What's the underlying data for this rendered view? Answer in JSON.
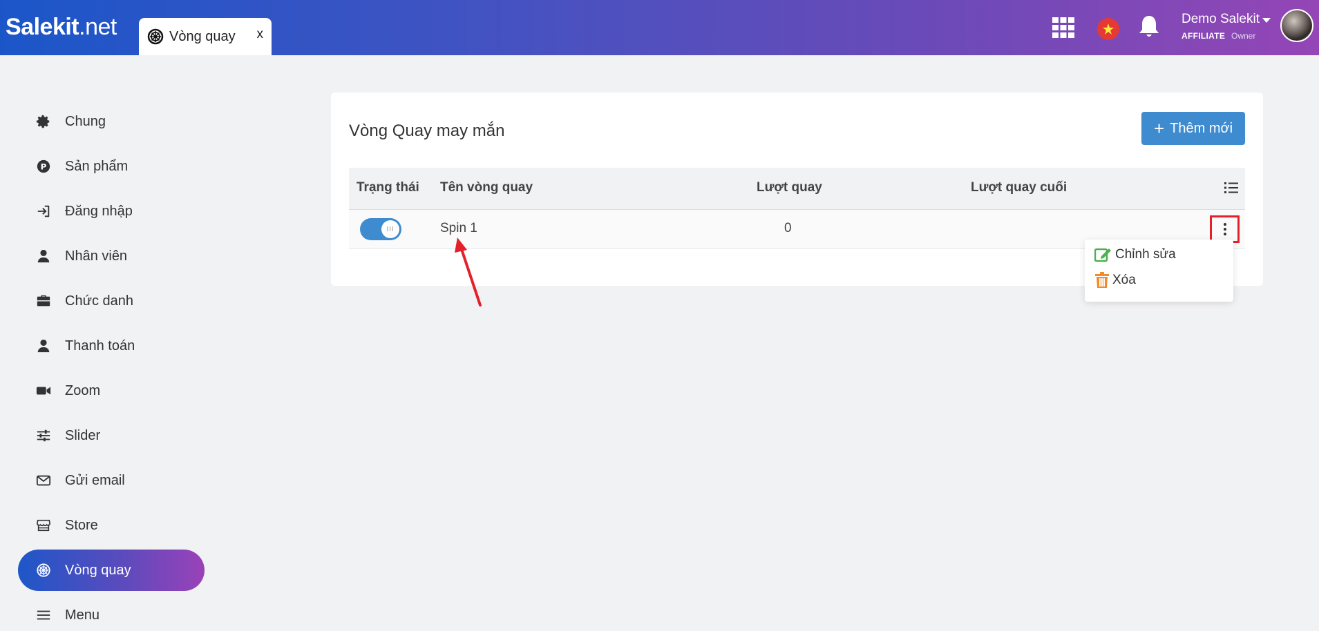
{
  "app": {
    "logo_main": "Salekit",
    "logo_suffix": ".net"
  },
  "tab": {
    "label": "Vòng quay",
    "close": "x"
  },
  "header": {
    "user_name": "Demo Salekit",
    "user_role": "AFFILIATE",
    "user_sub": "Owner",
    "icons": [
      "apps-grid-icon",
      "vietnam-flag-icon",
      "bell-icon",
      "avatar"
    ]
  },
  "sidebar": {
    "items": [
      {
        "label": "Chung",
        "icon": "gear-icon"
      },
      {
        "label": "Sản phẩm",
        "icon": "product-p-icon"
      },
      {
        "label": "Đăng nhập",
        "icon": "login-icon"
      },
      {
        "label": "Nhân viên",
        "icon": "user-icon"
      },
      {
        "label": "Chức danh",
        "icon": "briefcase-icon"
      },
      {
        "label": "Thanh toán",
        "icon": "user-icon"
      },
      {
        "label": "Zoom",
        "icon": "video-icon"
      },
      {
        "label": "Slider",
        "icon": "sliders-icon"
      },
      {
        "label": "Gửi email",
        "icon": "envelope-icon"
      },
      {
        "label": "Store",
        "icon": "store-icon"
      },
      {
        "label": "Vòng quay",
        "icon": "wheel-icon",
        "active": true
      },
      {
        "label": "Menu",
        "icon": "menu-icon"
      }
    ]
  },
  "main": {
    "title": "Vòng Quay may mắn",
    "add_button": "Thêm mới",
    "table": {
      "columns": [
        "Trạng thái",
        "Tên vòng quay",
        "Lượt quay",
        "Lượt quay cuối"
      ],
      "rows": [
        {
          "status_on": true,
          "toggle_glyph": "III",
          "name": "Spin 1",
          "spins": "0",
          "last_spin": ""
        }
      ]
    },
    "row_menu": {
      "edit": "Chỉnh sửa",
      "delete": "Xóa"
    }
  },
  "colors": {
    "accent": "#3f8bcf",
    "highlight": "#e3212b",
    "edit_icon": "#4caf50",
    "delete_icon": "#f28c28"
  }
}
